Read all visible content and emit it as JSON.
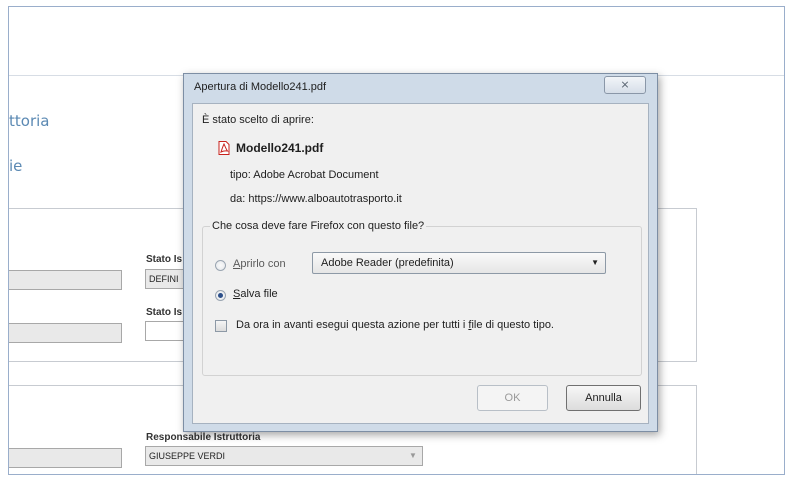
{
  "background": {
    "title": "ttoria",
    "subtitle": "ie",
    "panel1": {
      "field_left_1": "",
      "label_stato_1": "Stato Is",
      "field_stato_1": "DEFINI",
      "field_left_2": "",
      "label_stato_2": "Stato Is",
      "field_stato_2": ""
    },
    "panel2": {
      "field_left": "",
      "label_responsabile": "Responsabile Istruttoria",
      "responsabile_value": "GIUSEPPE VERDI"
    }
  },
  "dialog": {
    "title": "Apertura di Modello241.pdf",
    "close_symbol": "⨯",
    "chosen_label": "È stato scelto di aprire:",
    "file_name": "Modello241.pdf",
    "file_icon": "pdf-file-icon",
    "type_line": "tipo:  Adobe Acrobat Document",
    "from_line": "da:  https://www.alboautotrasporto.it",
    "question": "Che cosa deve fare Firefox con questo file?",
    "open_with": {
      "prefix": "A",
      "rest": "prirlo con",
      "selected": false
    },
    "app_select": "Adobe Reader  (predefinita)",
    "save_file": {
      "prefix": "S",
      "rest": "alva file",
      "selected": true
    },
    "remember": {
      "before": "Da ora in avanti esegui questa azione per tutti i ",
      "key": "f",
      "after": "ile di questo tipo.",
      "checked": false
    },
    "ok_label": "OK",
    "cancel_label": "Annulla"
  },
  "colors": {
    "accent": "#5b89b3",
    "pdf_red": "#c8231e"
  }
}
